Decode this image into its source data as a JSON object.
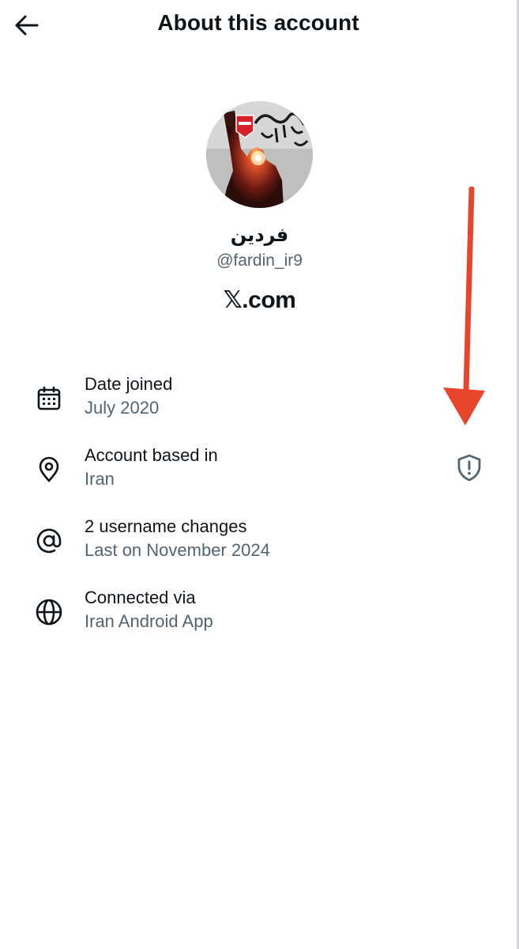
{
  "header": {
    "back_icon": "arrow-left-icon",
    "title": "About this account"
  },
  "profile": {
    "avatar_icon": "profile-avatar",
    "display_name": "فردین",
    "handle": "@fardin_ir9",
    "brand": "𝕏.com"
  },
  "info": [
    {
      "icon": "calendar-icon",
      "label": "Date joined",
      "value": "July 2020"
    },
    {
      "icon": "location-pin-icon",
      "label": "Account based in",
      "value": "Iran"
    },
    {
      "icon": "at-sign-icon",
      "label": "2 username changes",
      "value": "Last on November 2024"
    },
    {
      "icon": "globe-icon",
      "label": "Connected via",
      "value": "Iran Android App"
    }
  ],
  "shield": {
    "icon": "shield-exclamation-icon"
  },
  "annotation": {
    "icon": "red-arrow-down-icon",
    "color": "#e8452c"
  },
  "colors": {
    "primary_text": "#0f1419",
    "secondary_text": "#536471",
    "shield_gray": "#536471"
  }
}
